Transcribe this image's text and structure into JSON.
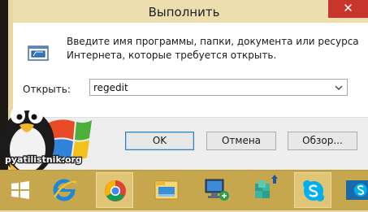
{
  "window": {
    "title": "Выполнить",
    "close_glyph": "✕",
    "description_line1": "Введите имя программы, папки, документа или ресурса",
    "description_line2": "Интернета, которые требуется открыть.",
    "open_label": "Открыть:",
    "open_value": "regedit",
    "buttons": {
      "ok": "OK",
      "cancel": "Отмена",
      "browse": "Обзор..."
    }
  },
  "logo": {
    "text": "pyatilistnik.org"
  },
  "taskbar": {
    "items": [
      {
        "icon": "windows-start-icon"
      },
      {
        "icon": "internet-explorer-icon"
      },
      {
        "icon": "chrome-icon",
        "active": true
      },
      {
        "icon": "file-explorer-icon"
      },
      {
        "icon": "network-computer-icon"
      },
      {
        "icon": "package-icon"
      },
      {
        "icon": "skype-icon",
        "active": true
      },
      {
        "icon": "skype-partial-icon"
      }
    ]
  },
  "colors": {
    "frame": "#ecdeae",
    "taskbar": "#c7a74e",
    "close": "#c7352c"
  }
}
